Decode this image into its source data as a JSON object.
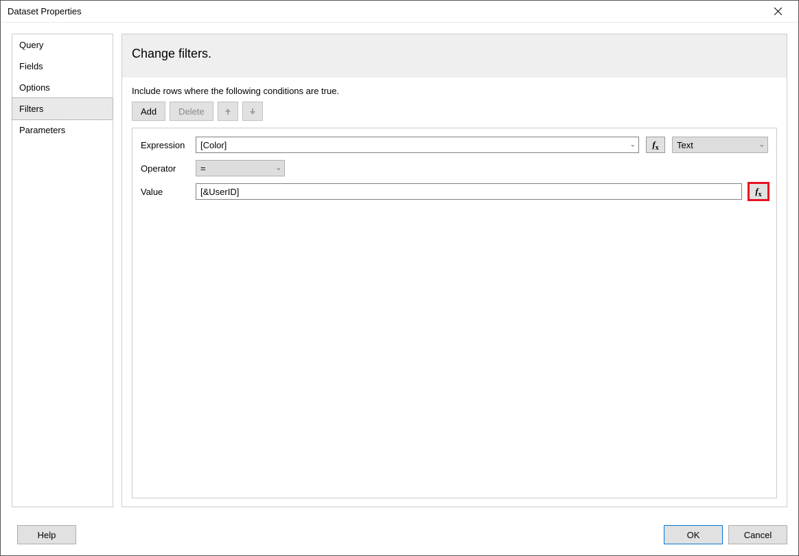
{
  "window": {
    "title": "Dataset Properties"
  },
  "sidebar": {
    "items": [
      {
        "label": "Query",
        "selected": false
      },
      {
        "label": "Fields",
        "selected": false
      },
      {
        "label": "Options",
        "selected": false
      },
      {
        "label": "Filters",
        "selected": true
      },
      {
        "label": "Parameters",
        "selected": false
      }
    ]
  },
  "content": {
    "heading": "Change filters.",
    "instruction": "Include rows where the following conditions are true.",
    "buttons": {
      "add": "Add",
      "delete": "Delete"
    },
    "filter": {
      "labels": {
        "expression": "Expression",
        "operator": "Operator",
        "value": "Value"
      },
      "expression_value": "[Color]",
      "expression_type": "Text",
      "operator_value": "=",
      "value_value": "[&UserID]"
    }
  },
  "footer": {
    "help": "Help",
    "ok": "OK",
    "cancel": "Cancel"
  }
}
